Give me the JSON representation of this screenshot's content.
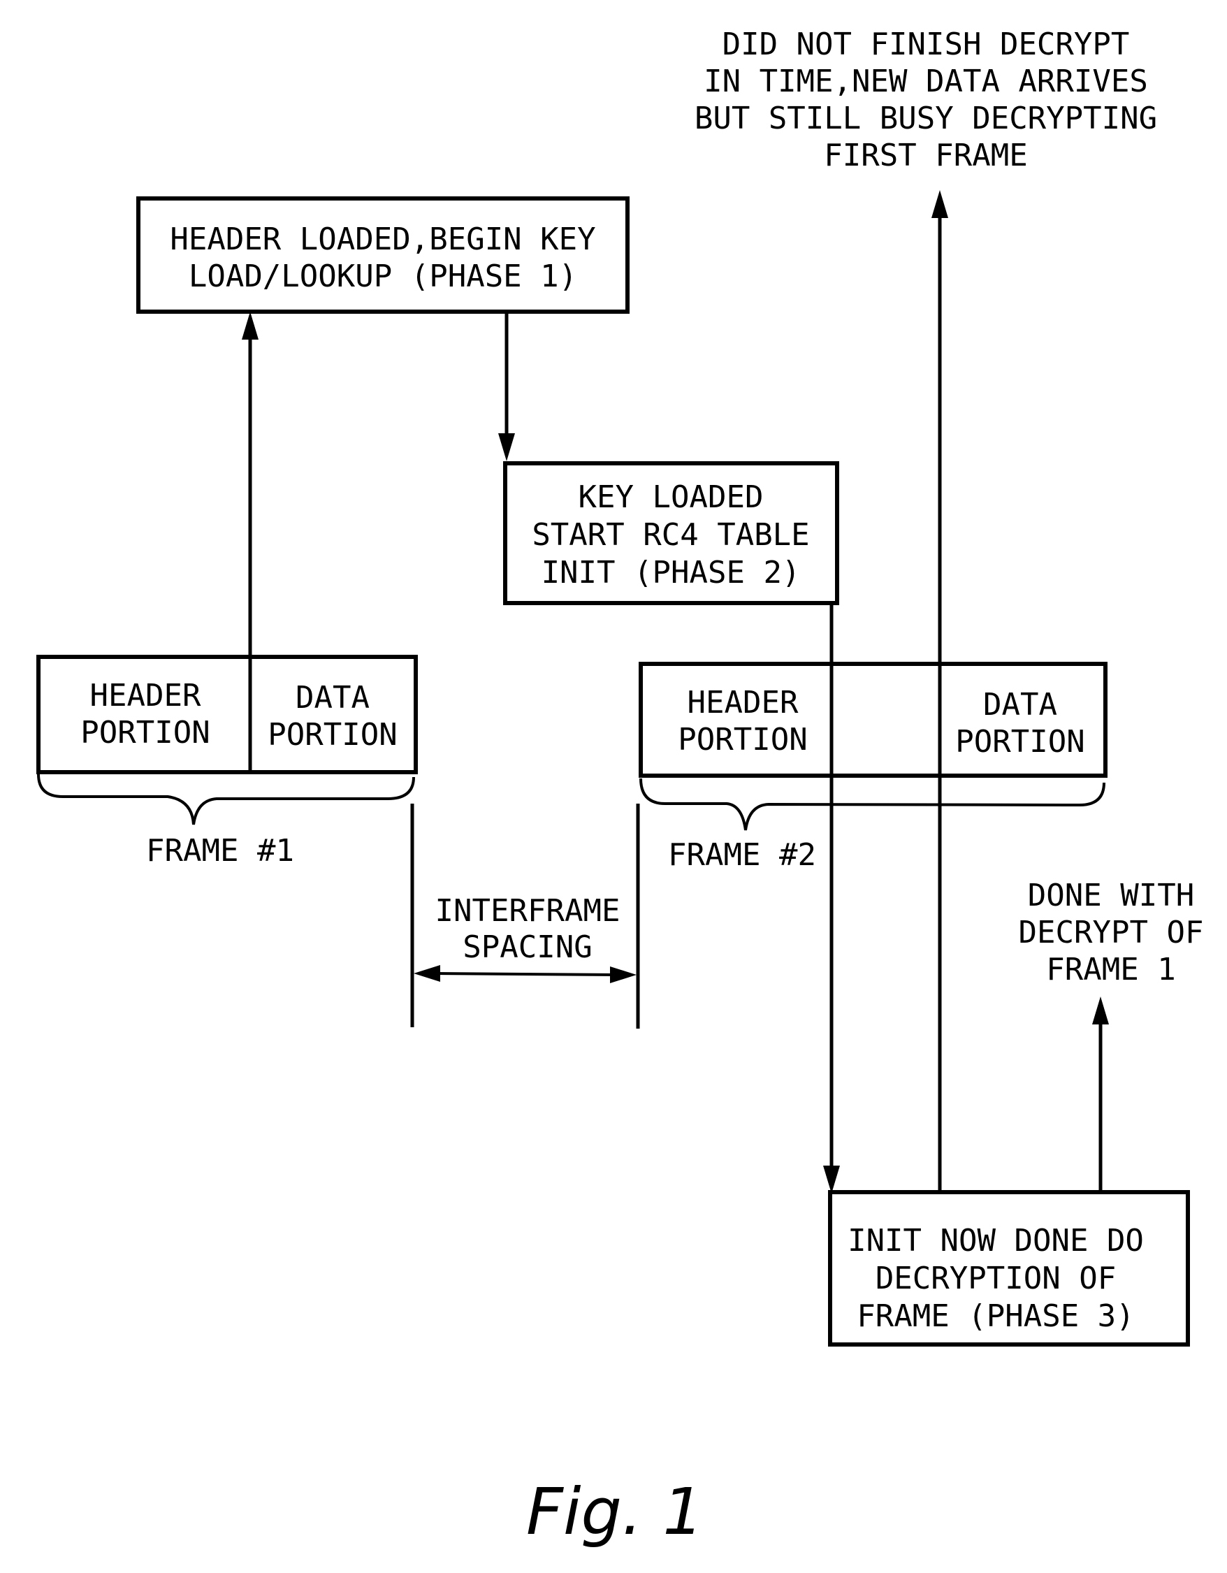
{
  "figure_label": "Fig. 1",
  "notes": {
    "did_not_finish": [
      "DID NOT FINISH DECRYPT",
      "IN TIME,NEW DATA ARRIVES",
      "BUT STILL BUSY DECRYPTING",
      "FIRST FRAME"
    ],
    "done_with_decrypt": [
      "DONE WITH",
      "DECRYPT OF",
      "FRAME 1"
    ]
  },
  "phases": {
    "phase1": [
      "HEADER LOADED,BEGIN KEY",
      "LOAD/LOOKUP (PHASE 1)"
    ],
    "phase2": [
      "KEY LOADED",
      "START RC4 TABLE",
      "INIT (PHASE 2)"
    ],
    "phase3": [
      "INIT NOW DONE DO",
      "DECRYPTION OF",
      "FRAME (PHASE 3)"
    ]
  },
  "frames": [
    {
      "label": "FRAME #1",
      "header": [
        "HEADER",
        "PORTION"
      ],
      "data": [
        "DATA",
        "PORTION"
      ]
    },
    {
      "label": "FRAME #2",
      "header": [
        "HEADER",
        "PORTION"
      ],
      "data": [
        "DATA",
        "PORTION"
      ]
    }
  ],
  "interframe": [
    "INTERFRAME",
    "SPACING"
  ]
}
